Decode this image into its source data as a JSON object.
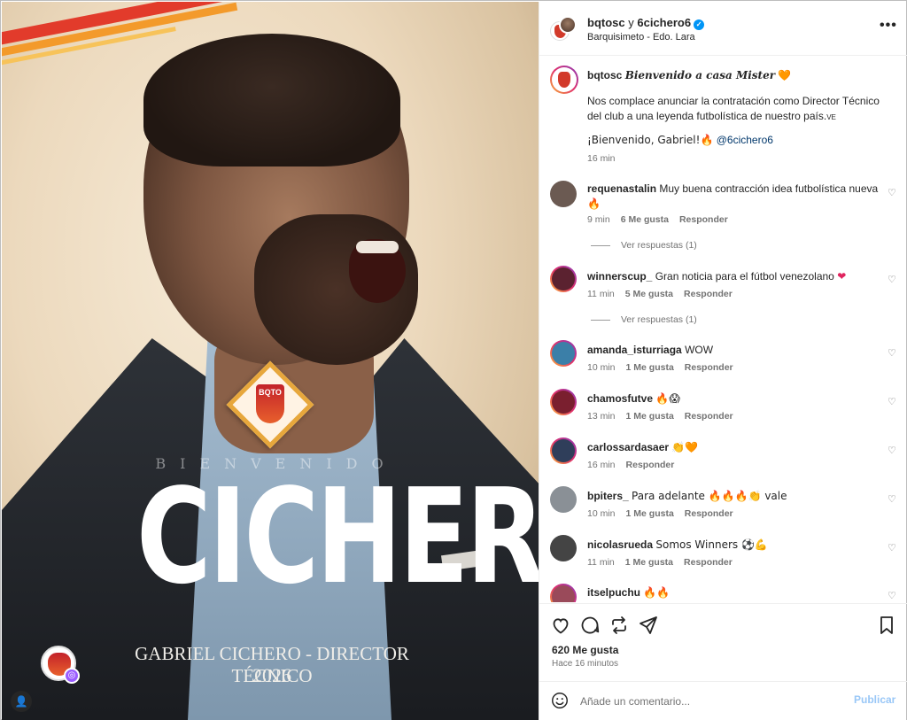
{
  "post_image": {
    "welcome_word": "BIENVENIDO",
    "surname": "CICHERO",
    "role_line": "GABRIEL CICHERO - DIRECTOR TÉCNICO",
    "year": "2026",
    "badge_text": "BQTO"
  },
  "header": {
    "account_primary": "bqtosc",
    "joiner": "y",
    "account_collab": "6cichero6",
    "verified_icon": "✓",
    "location": "Barquisimeto - Edo. Lara",
    "more_icon": "•••"
  },
  "caption": {
    "username": "bqtosc",
    "title": "Bienvenido a casa Mister",
    "title_emoji": "🧡",
    "body_line1": "Nos complace anunciar la contratación como Director Técnico",
    "body_line2": "del club a una leyenda futbolística de nuestro país.",
    "body_flag": "VE",
    "welcome": "¡Bienvenido, Gabriel!🔥",
    "mention": "@6cichero6",
    "time": "16 min"
  },
  "comments": [
    {
      "username": "requenastalin",
      "text": "Muy buena contracción idea futbolística nueva",
      "text2": "🔥",
      "time": "9 min",
      "likes": "6 Me gusta",
      "reply": "Responder",
      "replies": "Ver respuestas (1)",
      "avatar_color": "#6b5a52"
    },
    {
      "username": "winnerscup_",
      "text": "Gran noticia para el fútbol venezolano",
      "emoji": "❤",
      "time": "11 min",
      "likes": "5 Me gusta",
      "reply": "Responder",
      "replies": "Ver respuestas (1)",
      "avatar_color": "#5b2230"
    },
    {
      "username": "amanda_isturriaga",
      "text": "WOW",
      "time": "10 min",
      "likes": "1 Me gusta",
      "reply": "Responder",
      "avatar_color": "#3b7fa8"
    },
    {
      "username": "chamosfutve",
      "text": "🔥😱",
      "time": "13 min",
      "likes": "1 Me gusta",
      "reply": "Responder",
      "avatar_color": "#7a1f2f"
    },
    {
      "username": "carlossardasaer",
      "text": "👏🧡",
      "time": "16 min",
      "likes": "",
      "reply": "Responder",
      "avatar_color": "#2f3e5a"
    },
    {
      "username": "bpiters_",
      "text": "Para adelante 🔥🔥🔥👏 vale",
      "time": "10 min",
      "likes": "1 Me gusta",
      "reply": "Responder",
      "avatar_color": "#8a9096"
    },
    {
      "username": "nicolasrueda",
      "text": "Somos Winners ⚽💪",
      "time": "11 min",
      "likes": "1 Me gusta",
      "reply": "Responder",
      "avatar_color": "#444444"
    },
    {
      "username": "itselpuchu",
      "text": "🔥🔥",
      "time": "",
      "likes": "",
      "reply": "",
      "avatar_color": "#9a4a5a"
    }
  ],
  "actions": {
    "like_icon": "heart-icon",
    "comment_icon": "comment-icon",
    "share_icon": "repost-icon",
    "send_icon": "send-icon",
    "save_icon": "bookmark-icon",
    "likes_count": "620 Me gusta",
    "posted_ago": "Hace 16 minutos"
  },
  "add_comment": {
    "placeholder": "Añade un comentario...",
    "publish_label": "Publicar"
  },
  "colors": {
    "accent_blue": "#0095f6",
    "publish_disabled": "#99c7f7",
    "text_primary": "#262626",
    "text_secondary": "#737373"
  }
}
